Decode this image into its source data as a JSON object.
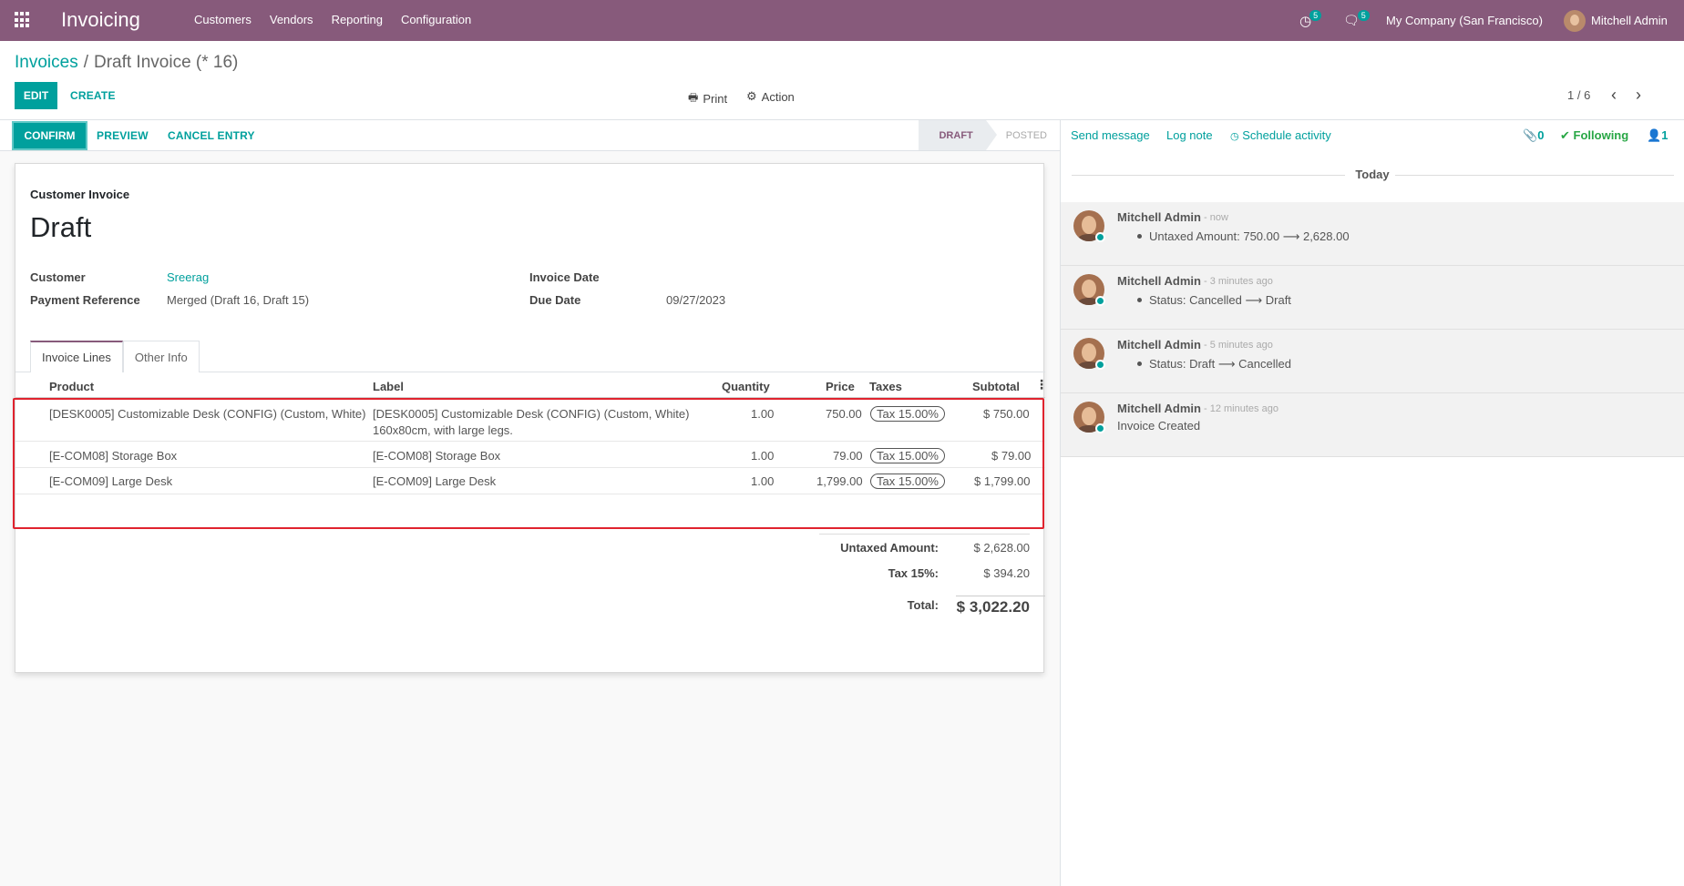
{
  "navbar": {
    "app_name": "Invoicing",
    "menu": [
      "Customers",
      "Vendors",
      "Reporting",
      "Configuration"
    ],
    "activity_count": "5",
    "messages_count": "5",
    "company": "My Company (San Francisco)",
    "user": "Mitchell Admin"
  },
  "breadcrumb": {
    "parent": "Invoices",
    "current": "Draft Invoice (* 16)"
  },
  "control_panel": {
    "edit_label": "EDIT",
    "create_label": "CREATE",
    "print_label": "Print",
    "action_label": "Action",
    "pager": "1 / 6"
  },
  "statusbar": {
    "confirm_label": "CONFIRM",
    "preview_label": "PREVIEW",
    "cancel_label": "CANCEL ENTRY",
    "steps": [
      "DRAFT",
      "POSTED"
    ]
  },
  "invoice": {
    "subtitle": "Customer Invoice",
    "title": "Draft",
    "customer_label": "Customer",
    "customer": "Sreerag",
    "payment_ref_label": "Payment Reference",
    "payment_ref": "Merged (Draft 16, Draft 15)",
    "invoice_date_label": "Invoice Date",
    "invoice_date": "",
    "due_date_label": "Due Date",
    "due_date": "09/27/2023",
    "tabs": [
      "Invoice Lines",
      "Other Info"
    ]
  },
  "lines": {
    "headers": {
      "product": "Product",
      "label": "Label",
      "quantity": "Quantity",
      "price": "Price",
      "taxes": "Taxes",
      "subtotal": "Subtotal"
    },
    "rows": [
      {
        "product": "[DESK0005] Customizable Desk (CONFIG) (Custom, White)",
        "label_1": "[DESK0005] Customizable Desk (CONFIG) (Custom, White)",
        "label_2": "160x80cm, with large legs.",
        "quantity": "1.00",
        "price": "750.00",
        "tax": "Tax 15.00%",
        "subtotal": "$ 750.00"
      },
      {
        "product": "[E-COM08] Storage Box",
        "label_1": "[E-COM08] Storage Box",
        "label_2": "",
        "quantity": "1.00",
        "price": "79.00",
        "tax": "Tax 15.00%",
        "subtotal": "$ 79.00"
      },
      {
        "product": "[E-COM09] Large Desk",
        "label_1": "[E-COM09] Large Desk",
        "label_2": "",
        "quantity": "1.00",
        "price": "1,799.00",
        "tax": "Tax 15.00%",
        "subtotal": "$ 1,799.00"
      }
    ]
  },
  "totals": {
    "untaxed_label": "Untaxed Amount:",
    "untaxed": "$ 2,628.00",
    "tax_label": "Tax 15%:",
    "tax": "$ 394.20",
    "total_label": "Total:",
    "total": "$ 3,022.20"
  },
  "chatter": {
    "send_message": "Send message",
    "log_note": "Log note",
    "schedule_activity": "Schedule activity",
    "attachments": "0",
    "following": "Following",
    "followers": "1",
    "today": "Today",
    "messages": [
      {
        "author": "Mitchell Admin",
        "time": "- now",
        "bullet": true,
        "text": "Untaxed Amount: 750.00 ⟶ 2,628.00"
      },
      {
        "author": "Mitchell Admin",
        "time": "- 3 minutes ago",
        "bullet": true,
        "text": "Status: Cancelled ⟶ Draft"
      },
      {
        "author": "Mitchell Admin",
        "time": "- 5 minutes ago",
        "bullet": true,
        "text": "Status: Draft ⟶ Cancelled"
      },
      {
        "author": "Mitchell Admin",
        "time": "- 12 minutes ago",
        "bullet": false,
        "text": "Invoice Created"
      }
    ]
  },
  "colors": {
    "navbar": "#875a7b",
    "accent": "#00a09d",
    "highlight": "#e0232e"
  }
}
